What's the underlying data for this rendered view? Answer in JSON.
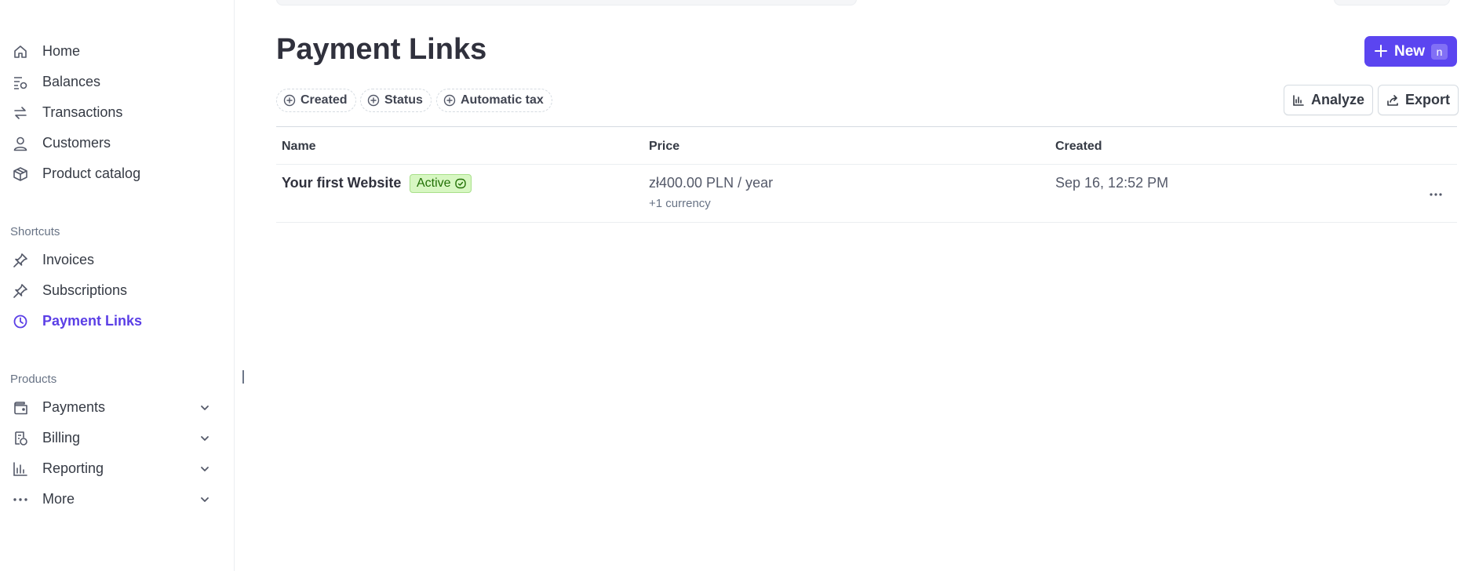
{
  "sidebar": {
    "items": [
      {
        "label": "Home",
        "icon": "home-icon"
      },
      {
        "label": "Balances",
        "icon": "balances-icon"
      },
      {
        "label": "Transactions",
        "icon": "arrows-icon"
      },
      {
        "label": "Customers",
        "icon": "person-icon"
      },
      {
        "label": "Product catalog",
        "icon": "box-icon"
      }
    ],
    "shortcuts_title": "Shortcuts",
    "shortcuts": [
      {
        "label": "Invoices",
        "icon": "pin-icon"
      },
      {
        "label": "Subscriptions",
        "icon": "pin-icon"
      },
      {
        "label": "Payment Links",
        "icon": "clock-icon",
        "active": true
      }
    ],
    "products_title": "Products",
    "products": [
      {
        "label": "Payments",
        "icon": "wallet-icon"
      },
      {
        "label": "Billing",
        "icon": "billing-icon"
      },
      {
        "label": "Reporting",
        "icon": "bar-chart-icon"
      },
      {
        "label": "More",
        "icon": "dots-icon"
      }
    ]
  },
  "header": {
    "title": "Payment Links",
    "new_button": {
      "label": "New",
      "shortcut": "n"
    }
  },
  "filters": [
    {
      "label": "Created"
    },
    {
      "label": "Status"
    },
    {
      "label": "Automatic tax"
    }
  ],
  "actions": {
    "analyze_label": "Analyze",
    "export_label": "Export"
  },
  "table": {
    "columns": [
      "Name",
      "Price",
      "Created"
    ],
    "rows": [
      {
        "name": "Your first Website",
        "status": "Active",
        "price": "zł400.00 PLN / year",
        "price_sub": "+1 currency",
        "created": "Sep 16, 12:52 PM"
      }
    ]
  },
  "colors": {
    "accent": "#5b45f0",
    "active_nav": "#5b3fe6",
    "badge_bg": "#d7f7c2",
    "badge_text": "#217005"
  }
}
